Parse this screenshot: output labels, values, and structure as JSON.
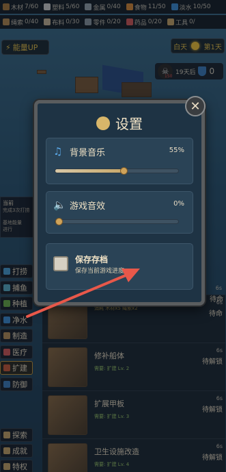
{
  "resources_row1": [
    {
      "name": "木材",
      "value": "7/60",
      "color": "#a97a3f"
    },
    {
      "name": "塑料",
      "value": "5/60",
      "color": "#d2d2d2"
    },
    {
      "name": "金属",
      "value": "0/40",
      "color": "#9aa7b0"
    },
    {
      "name": "食物",
      "value": "11/50",
      "color": "#d98b3a"
    },
    {
      "name": "淡水",
      "value": "10/50",
      "color": "#3d8fd8"
    }
  ],
  "resources_row2": [
    {
      "name": "绳索",
      "value": "0/40",
      "color": "#b58a52"
    },
    {
      "name": "布料",
      "value": "0/30",
      "color": "#c9b79a"
    },
    {
      "name": "零件",
      "value": "0/20",
      "color": "#8c9aa5"
    },
    {
      "name": "药品",
      "value": "0/20",
      "color": "#d65a5a"
    },
    {
      "name": "工具",
      "value": "0/",
      "color": "#c8a76a"
    }
  ],
  "energy_label": "能量UP",
  "day": {
    "phase": "白天",
    "count": "第1天"
  },
  "threat": {
    "days": "19天后",
    "value": "0",
    "sub": "150"
  },
  "side_panel": {
    "title": "当前",
    "line1": "完成3次打捞",
    "line2": "基地能量",
    "line3": "进行"
  },
  "side_menu": [
    "打捞",
    "捕鱼",
    "种植",
    "净水",
    "制造",
    "医疗",
    "扩建",
    "防御"
  ],
  "side_menu_bottom": [
    "探索",
    "成就",
    "特权"
  ],
  "tasks": [
    {
      "name": "",
      "req": "消耗 木材x5 绳索x2",
      "cost": "",
      "secs": "6s",
      "status": "待命"
    },
    {
      "name": "修补船体",
      "req": "需要: 扩建 Lv. 2",
      "cost": "",
      "secs": "6s",
      "status": "待解锁"
    },
    {
      "name": "扩展甲板",
      "req": "需要: 扩建 Lv. 3",
      "cost": "",
      "secs": "6s",
      "status": "待解锁"
    },
    {
      "name": "卫生设施改造",
      "req": "需要: 扩建 Lv. 4",
      "cost": "",
      "secs": "6s",
      "status": "待解锁"
    }
  ],
  "top_right_task": {
    "secs": "6s",
    "status": "待命"
  },
  "dialog": {
    "title": "设置",
    "music": {
      "label": "背景音乐",
      "percent": "55%",
      "level": 0.55
    },
    "sfx": {
      "label": "游戏音效",
      "percent": "0%",
      "level": 0.0
    },
    "save": {
      "title": "保存存档",
      "subtitle": "保存当前游戏进度"
    }
  },
  "colors": {
    "accent": "#e8c24a",
    "dialog_bg": "#1e3344",
    "arrow": "#e8584a"
  }
}
